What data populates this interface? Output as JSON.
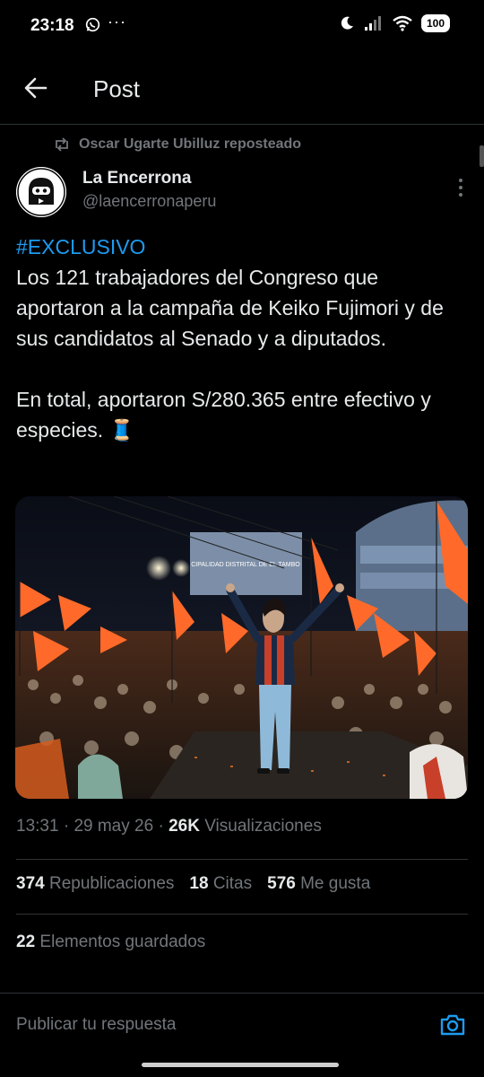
{
  "status_bar": {
    "time": "23:18",
    "dots": "···",
    "battery": "100"
  },
  "header": {
    "title": "Post"
  },
  "repost": {
    "text": "Oscar Ugarte Ubilluz reposteado"
  },
  "author": {
    "name": "La Encerrona",
    "handle": "@laencerronaperu"
  },
  "tweet": {
    "hashtag": "#EXCLUSIVO",
    "body": "\nLos 121 trabajadores del Congreso que aportaron a la campaña de Keiko Fujimori y de sus candidatos al Senado y a diputados.\n\nEn total, aportaron S/280.365 entre efectivo y especies. 🧵"
  },
  "photo": {
    "building_sign": "CIPALIDAD DISTRITAL DE EL TAMBO"
  },
  "meta": {
    "time": "13:31",
    "sep1": " · ",
    "date": "29 may 26",
    "sep2": " · ",
    "views_count": "26K",
    "views_label": "Visualizaciones"
  },
  "stats": {
    "reposts_count": "374",
    "reposts_label": "Republicaciones",
    "quotes_count": "18",
    "quotes_label": "Citas",
    "likes_count": "576",
    "likes_label": "Me gusta",
    "saved_count": "22",
    "saved_label": "Elementos guardados"
  },
  "reply": {
    "placeholder": "Publicar tu respuesta"
  },
  "colors": {
    "background": "#000000",
    "text": "#e7e9ea",
    "secondary": "#71767b",
    "accent": "#1d9bf0",
    "divider": "#2f3336"
  }
}
